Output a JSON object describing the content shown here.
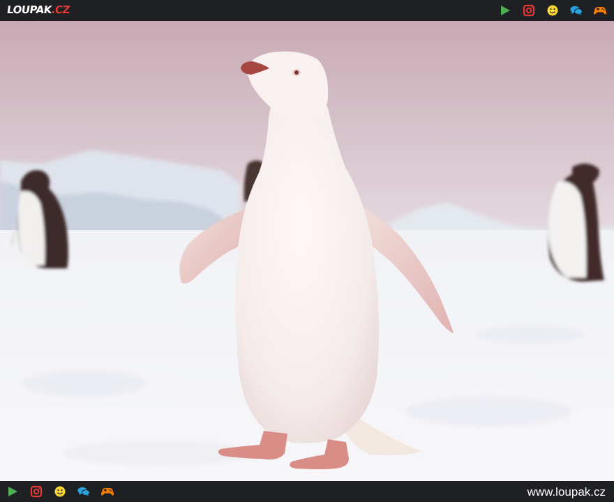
{
  "header": {
    "logo_main": "LOUPAK",
    "logo_tld": ".CZ"
  },
  "icons": [
    "play-icon",
    "instagram-icon",
    "smiley-icon",
    "chat-icon",
    "gamepad-icon"
  ],
  "colors": {
    "bar_background": "#1f2023",
    "play_green": "#4caf50",
    "instagram_red": "#e53935",
    "smiley_yellow": "#fdd835",
    "chat_blue": "#29a3e0",
    "gamepad_orange": "#f57c00"
  },
  "photo": {
    "subject": "albino penguin on snow"
  },
  "footer": {
    "site_url": "www.loupak.cz"
  }
}
